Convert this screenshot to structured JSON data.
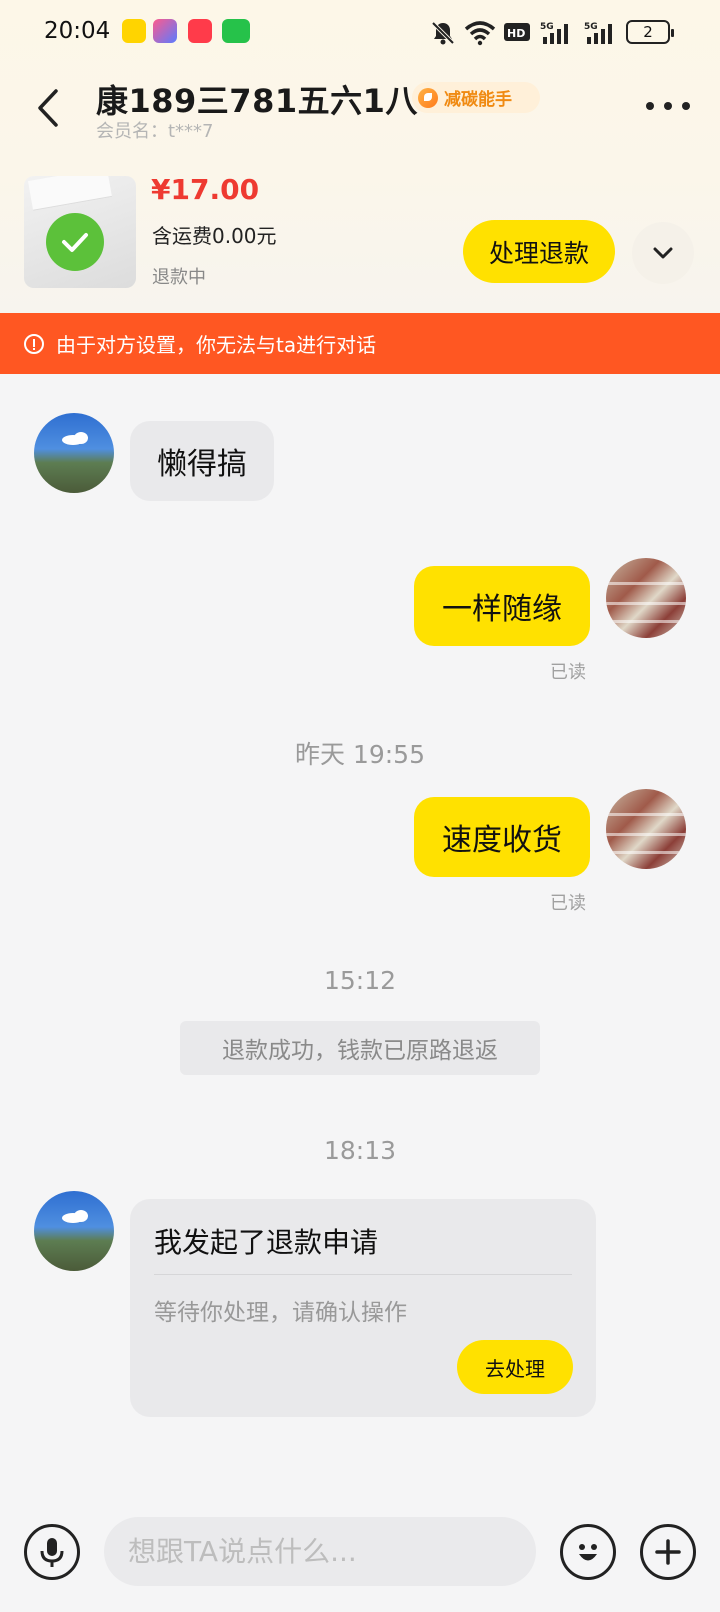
{
  "status_bar": {
    "time": "20:04",
    "app_icons": [
      "fish-app-icon",
      "shortcut-app-icon",
      "music-app-icon",
      "chat-app-icon"
    ],
    "icons": [
      "mute-bell-icon",
      "wifi-icon",
      "hd-icon",
      "signal-5g-icon",
      "signal-5g-icon-2"
    ],
    "battery": "2"
  },
  "header": {
    "title": "康189三781五六1八",
    "badge": "减碳能手",
    "member_label": "会员名：t***7"
  },
  "product": {
    "price": "¥17.00",
    "shipping": "含运费0.00元",
    "status": "退款中",
    "action_label": "处理退款"
  },
  "banner": {
    "text": "由于对方设置，你无法与ta进行对话"
  },
  "messages": {
    "m1": "懒得搞",
    "m2": "一样随缘",
    "m2_read": "已读",
    "sep1": "昨天 19:55",
    "m3": "速度收货",
    "m3_read": "已读",
    "sep2": "15:12",
    "system": "退款成功，钱款已原路退返",
    "sep3": "18:13",
    "card": {
      "title": "我发起了退款申请",
      "desc": "等待你处理，请确认操作",
      "button": "去处理"
    }
  },
  "input": {
    "placeholder": "想跟TA说点什么..."
  },
  "colors": {
    "accent_yellow": "#ffe100",
    "banner_orange": "#ff5722",
    "price_red": "#ee3a31"
  }
}
